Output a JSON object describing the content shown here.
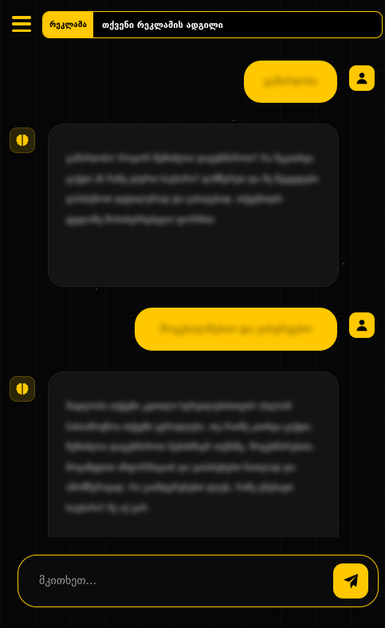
{
  "header": {
    "ad_badge": "რეკლამა",
    "ad_text": "თქვენი რეკლამის ადგილი"
  },
  "messages": [
    {
      "role": "user",
      "text": "გამარჯობა"
    },
    {
      "role": "bot",
      "text": "გამარჯობა! როგორ შემიძლია დაგეხმაროთ? რა შეკითხვა გაქვთ ან რაზე გსურთ საუბარი? დამწერეთ და მე შევეცდები გიპასუხოთ დეტალურად და გასაგებად, თქვენთვის ყველაზე მოსახერხებელი ფორმით."
    },
    {
      "role": "user",
      "text": "მოგესალმებით და გისურვებთ"
    },
    {
      "role": "bot",
      "text": "მადლობა თქვენი კეთილი სურვილებისთვის! ძალიან სასიამოვნოა თქვენი ყურადღება. თუ რაიმე კითხვა გაქვთ, შემიძლია დაგეხმაროთ ნებისმიერ თემაზე. მოგეხმარებით, მოგაწვდით ინფორმაციას და გიპასუხებთ ნათლად და ამომწურავად. რა გაინტერესებთ დღეს, რაზე გნებავთ საუბარი? მე აქ ვარ."
    }
  ],
  "composer": {
    "placeholder": "მკითხეთ..."
  },
  "colors": {
    "accent": "#ffc800",
    "background": "#060606",
    "bot_bubble": "#141414"
  },
  "icons": {
    "menu": "hamburger-icon",
    "user_avatar": "user-icon",
    "bot_avatar": "brain-icon",
    "send": "paper-plane-icon"
  }
}
